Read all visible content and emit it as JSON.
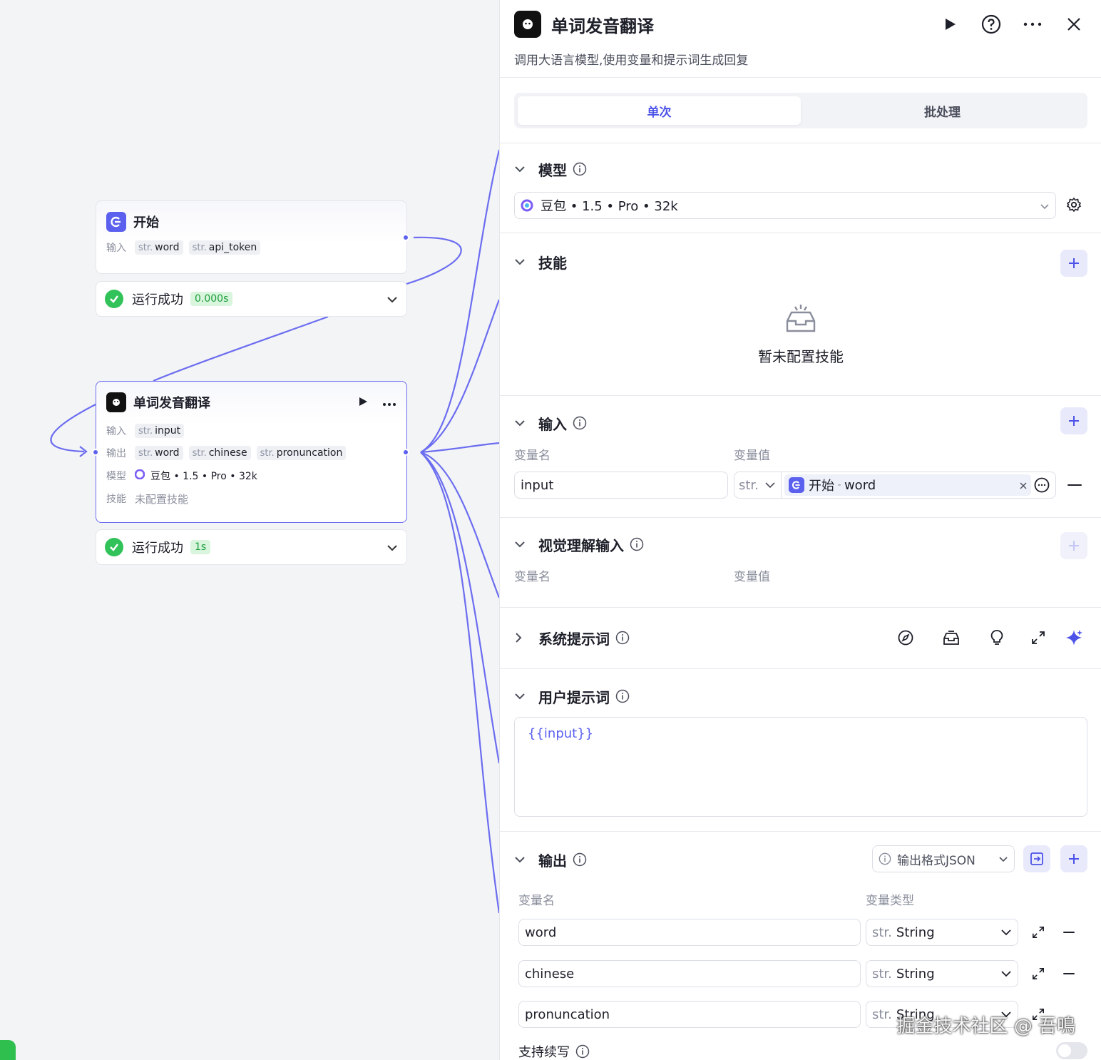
{
  "canvas": {
    "start_node": {
      "title": "开始",
      "input_label": "输入",
      "inputs": [
        {
          "type": "str.",
          "name": "word"
        },
        {
          "type": "str.",
          "name": "api_token"
        }
      ],
      "status": "运行成功",
      "time": "0.000s"
    },
    "llm_node": {
      "title": "单词发音翻译",
      "input_label": "输入",
      "inputs": [
        {
          "type": "str.",
          "name": "input"
        }
      ],
      "output_label": "输出",
      "outputs": [
        {
          "type": "str.",
          "name": "word"
        },
        {
          "type": "str.",
          "name": "chinese"
        },
        {
          "type": "str.",
          "name": "pronuncation"
        }
      ],
      "model_label": "模型",
      "model_value": "豆包 • 1.5 • Pro • 32k",
      "skill_label": "技能",
      "skill_value": "未配置技能",
      "status": "运行成功",
      "time": "1s"
    }
  },
  "panel": {
    "title": "单词发音翻译",
    "description": "调用大语言模型,使用变量和提示词生成回复",
    "tabs": [
      {
        "label": "单次",
        "active": true
      },
      {
        "label": "批处理",
        "active": false
      }
    ],
    "model": {
      "section": "模型",
      "value": "豆包 • 1.5 • Pro • 32k"
    },
    "skills": {
      "section": "技能",
      "empty": "暂未配置技能"
    },
    "input": {
      "section": "输入",
      "col_name": "变量名",
      "col_value": "变量值",
      "rows": [
        {
          "name": "input",
          "type": "str.",
          "ref_node": "开始",
          "ref_sep": " - ",
          "ref_var": "word"
        }
      ]
    },
    "vision": {
      "section": "视觉理解输入",
      "col_name": "变量名",
      "col_value": "变量值"
    },
    "system_prompt": {
      "section": "系统提示词"
    },
    "user_prompt": {
      "section": "用户提示词",
      "value": "{{input}}"
    },
    "output": {
      "section": "输出",
      "format": "输出格式JSON",
      "col_name": "变量名",
      "col_type": "变量类型",
      "rows": [
        {
          "name": "word",
          "type_prefix": "str.",
          "type": "String"
        },
        {
          "name": "chinese",
          "type_prefix": "str.",
          "type": "String"
        },
        {
          "name": "pronuncation",
          "type_prefix": "str.",
          "type": "String"
        }
      ],
      "continue_label": "支持续写",
      "continue_enabled": false
    }
  },
  "watermark": "掘金技术社区 @ 吾鳴",
  "colors": {
    "accent": "#4d53e8",
    "success": "#32c25a",
    "edge": "#5b61ee"
  }
}
